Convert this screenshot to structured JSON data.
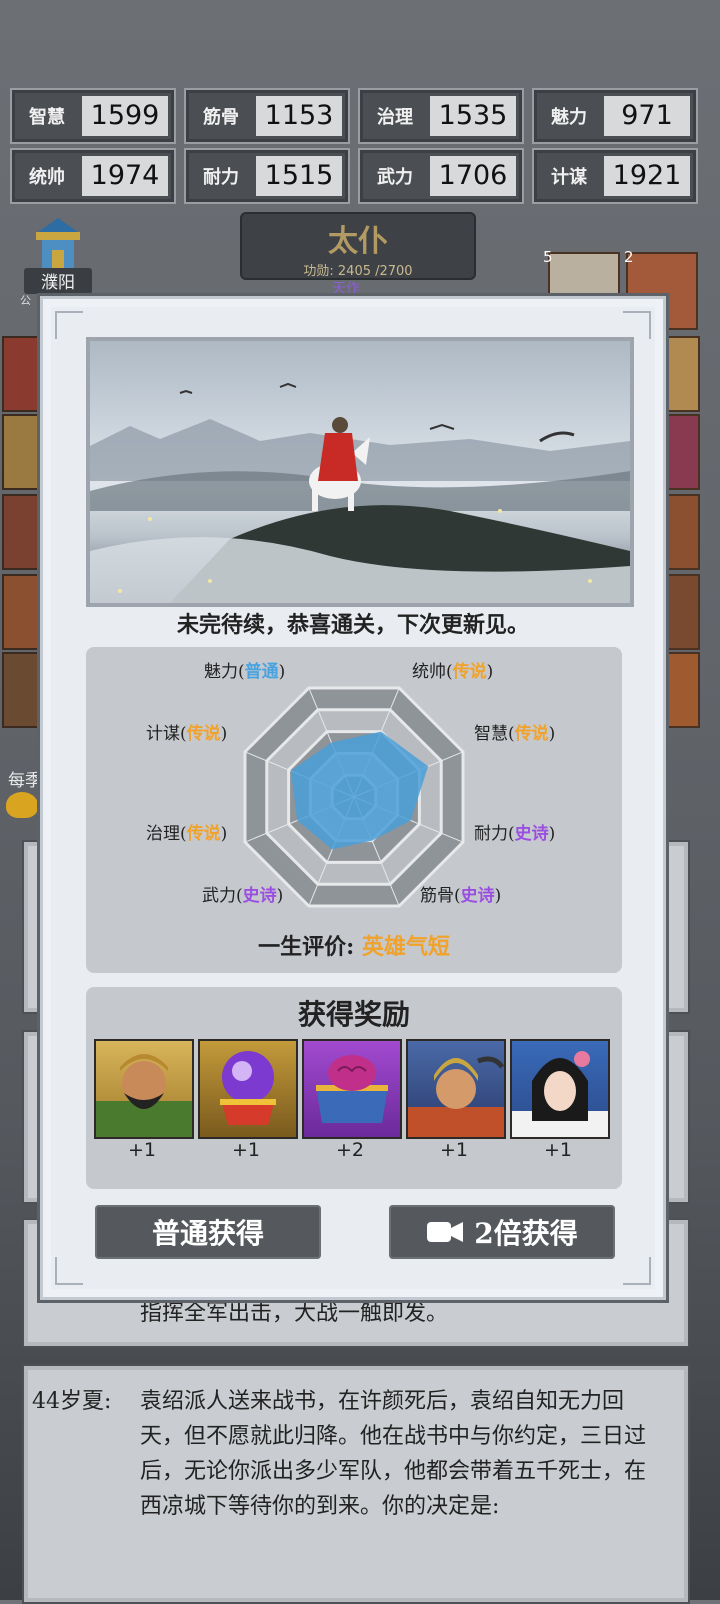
{
  "stats": [
    {
      "name": "智慧",
      "value": "1599"
    },
    {
      "name": "筋骨",
      "value": "1153"
    },
    {
      "name": "治理",
      "value": "1535"
    },
    {
      "name": "魅力",
      "value": "971"
    },
    {
      "name": "统帅",
      "value": "1974"
    },
    {
      "name": "耐力",
      "value": "1515"
    },
    {
      "name": "武力",
      "value": "1706"
    },
    {
      "name": "计谋",
      "value": "1921"
    }
  ],
  "rank": {
    "title": "太仆",
    "progress_text": "功勋: 2405 /2700",
    "sub": "天作"
  },
  "city": {
    "name": "濮阳",
    "sub": "公"
  },
  "side": {
    "text": "每季"
  },
  "right_badges": [
    "5",
    "2"
  ],
  "modal": {
    "caption": "未完待续，恭喜通关，下次更新见。",
    "radar": {
      "attributes": [
        {
          "name": "统帅",
          "grade": "传说",
          "level": 0.6
        },
        {
          "name": "智慧",
          "grade": "传说",
          "level": 0.68
        },
        {
          "name": "耐力",
          "grade": "史诗",
          "level": 0.52
        },
        {
          "name": "筋骨",
          "grade": "史诗",
          "level": 0.4
        },
        {
          "name": "武力",
          "grade": "史诗",
          "level": 0.48
        },
        {
          "name": "治理",
          "grade": "传说",
          "level": 0.52
        },
        {
          "name": "计谋",
          "grade": "传说",
          "level": 0.58
        },
        {
          "name": "魅力",
          "grade": "普通",
          "level": 0.5
        }
      ]
    },
    "life_eval_label": "一生评价: ",
    "life_eval_value": "英雄气短",
    "reward_title": "获得奖励",
    "rewards": [
      {
        "icon": "general-bearded-portrait",
        "count": "+1"
      },
      {
        "icon": "purple-orb-on-stand",
        "count": "+1"
      },
      {
        "icon": "brain-treasure-chest",
        "count": "+2"
      },
      {
        "icon": "helmeted-warrior-portrait",
        "count": "+1"
      },
      {
        "icon": "lady-portrait",
        "count": "+1"
      }
    ],
    "btn_normal": "普通获得",
    "btn_double": "2倍获得"
  },
  "story": [
    {
      "age": "",
      "text": "指挥全军出击，大战一触即发。"
    },
    {
      "age": "44岁夏:",
      "text": "袁绍派人送来战书，在许颜死后，袁绍自知无力回天，但不愿就此归降。他在战书中与你约定，三日过后，无论你派出多少军队，他都会带着五千死士，在西凉城下等待你的到来。你的决定是:"
    }
  ],
  "colors": {
    "legend": "#f0a22b",
    "epic": "#9b4fe0",
    "normal": "#4aa3df",
    "radar_fill": "#4a9fd8"
  }
}
